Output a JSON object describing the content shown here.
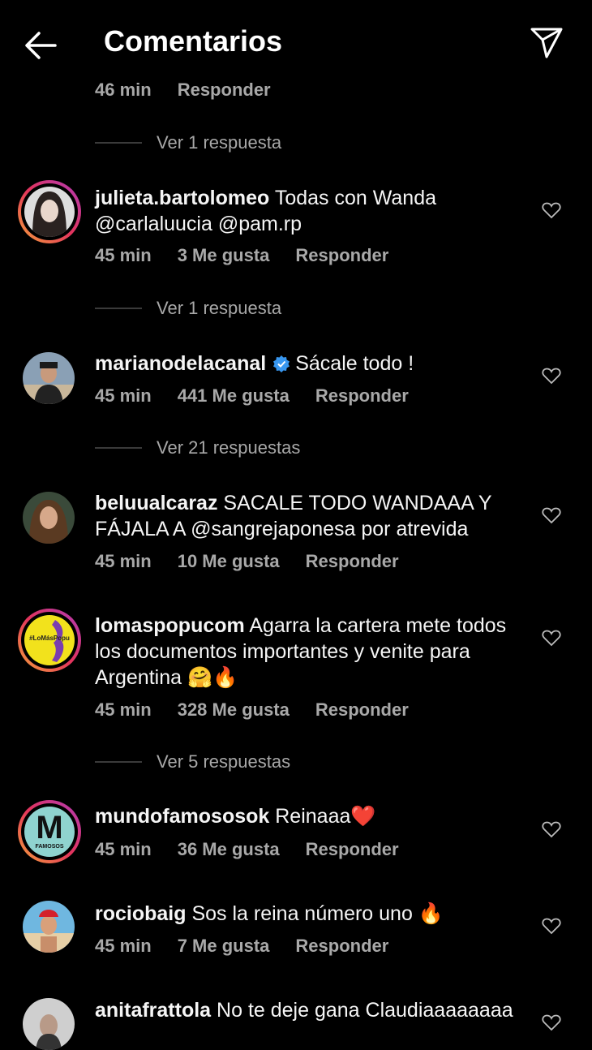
{
  "header": {
    "title": "Comentarios",
    "back_icon": "arrow-left-icon",
    "share_icon": "paper-plane-icon"
  },
  "top": {
    "time": "46 min",
    "reply": "Responder",
    "view_replies": "Ver 1 respuesta"
  },
  "comments": [
    {
      "username": "julieta.bartolomeo",
      "text": "Todas con Wanda @carlaluucia @pam.rp",
      "time": "45 min",
      "likes": "3 Me gusta",
      "reply": "Responder",
      "view_replies": "Ver 1 respuesta"
    },
    {
      "username": "marianodelacanal",
      "text": "Sácale todo !",
      "time": "45 min",
      "likes": "441 Me gusta",
      "reply": "Responder",
      "view_replies": "Ver 21 respuestas"
    },
    {
      "username": "beluualcaraz",
      "text": "SACALE TODO WANDAAA Y FÁJALA A @sangrejaponesa por atrevida",
      "time": "45 min",
      "likes": "10 Me gusta",
      "reply": "Responder"
    },
    {
      "username": "lomaspopucom",
      "text": "Agarra la cartera mete todos los documentos importantes y venite para Argentina 🤗🔥",
      "time": "45 min",
      "likes": "328 Me gusta",
      "reply": "Responder",
      "view_replies": "Ver 5 respuestas",
      "avatar_text": "#LoMásPopu"
    },
    {
      "username": "mundofamososok",
      "text": "Reinaaa❤️",
      "time": "45 min",
      "likes": "36 Me gusta",
      "reply": "Responder",
      "avatar_letter": "M",
      "avatar_sub": "FAMOSOS"
    },
    {
      "username": "rociobaig",
      "text": "Sos la reina número uno 🔥",
      "time": "45 min",
      "likes": "7 Me gusta",
      "reply": "Responder"
    },
    {
      "username": "anitafrattola",
      "text": "No te deje gana Claudiaaaaaaaa"
    }
  ],
  "colors": {
    "background": "#000000",
    "text": "#f5f5f5",
    "secondary": "#a8a8a8",
    "verified": "#3897f0"
  }
}
